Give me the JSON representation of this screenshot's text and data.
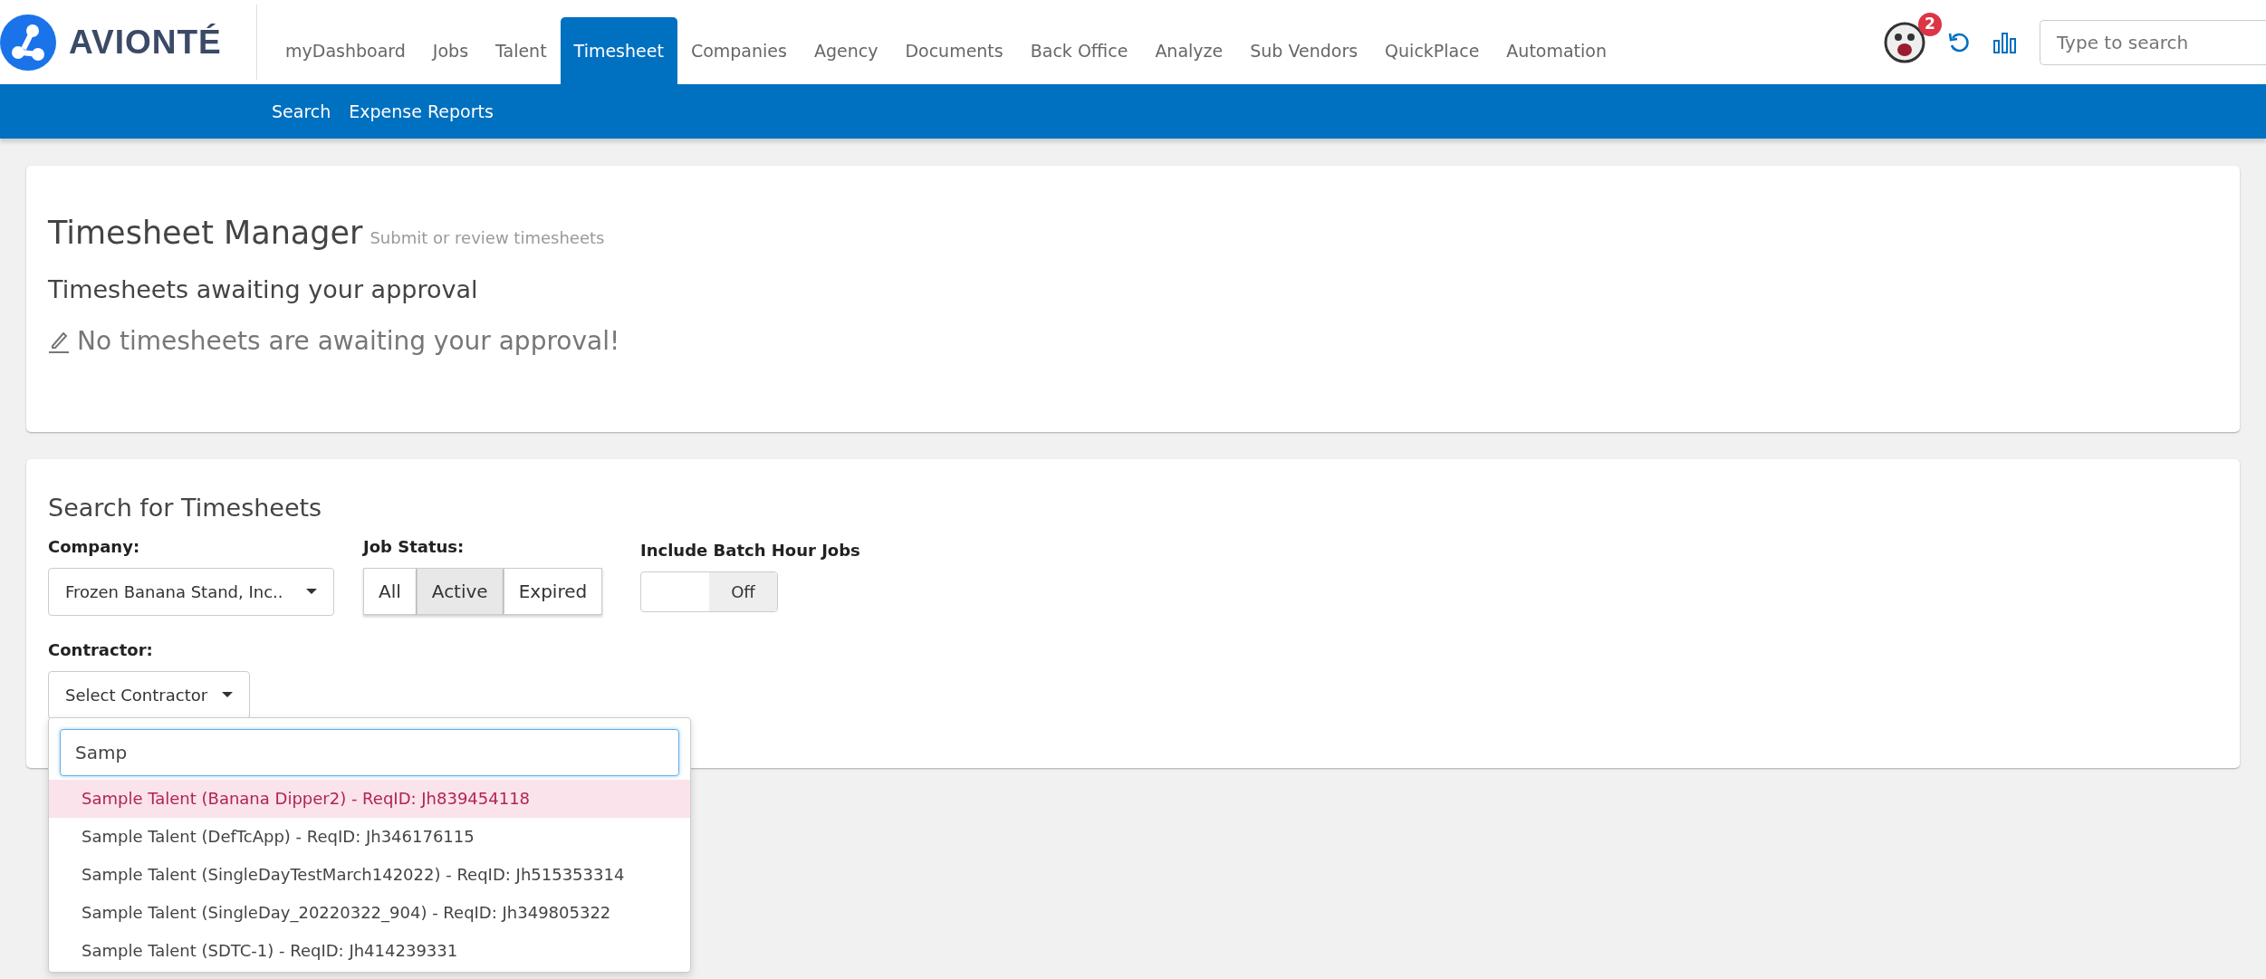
{
  "brand": {
    "name": "AVIONTÉ"
  },
  "nav": [
    {
      "label": "myDashboard",
      "selected": false
    },
    {
      "label": "Jobs",
      "selected": false
    },
    {
      "label": "Talent",
      "selected": false
    },
    {
      "label": "Timesheet",
      "selected": true
    },
    {
      "label": "Companies",
      "selected": false
    },
    {
      "label": "Agency",
      "selected": false
    },
    {
      "label": "Documents",
      "selected": false
    },
    {
      "label": "Back Office",
      "selected": false
    },
    {
      "label": "Analyze",
      "selected": false
    },
    {
      "label": "Sub Vendors",
      "selected": false
    },
    {
      "label": "QuickPlace",
      "selected": false
    },
    {
      "label": "Automation",
      "selected": false
    }
  ],
  "notifications": {
    "count": "2"
  },
  "search": {
    "placeholder": "Type to search"
  },
  "subnav": [
    "Search",
    "Expense Reports"
  ],
  "manager": {
    "title": "Timesheet Manager",
    "subtitle": "Submit or review timesheets",
    "heading": "Timesheets awaiting your approval",
    "message": "No timesheets are awaiting your approval!"
  },
  "search_form": {
    "title": "Search for Timesheets",
    "company": {
      "label": "Company:",
      "value": "Frozen Banana Stand, Inc.."
    },
    "job_status": {
      "label": "Job Status:",
      "options": [
        {
          "label": "All",
          "selected": false
        },
        {
          "label": "Active",
          "selected": true
        },
        {
          "label": "Expired",
          "selected": false
        }
      ]
    },
    "batch": {
      "label": "Include Batch Hour Jobs",
      "state": "Off",
      "on": false
    },
    "contractor": {
      "label": "Contractor:",
      "value": "Select Contractor",
      "dropdown": {
        "query": "Samp",
        "options": [
          {
            "label": "Sample Talent (Banana Dipper2) - ReqID: Jh839454118",
            "selected": true
          },
          {
            "label": "Sample Talent (DefTcApp) - ReqID: Jh346176115",
            "selected": false
          },
          {
            "label": "Sample Talent (SingleDayTestMarch142022) - ReqID: Jh515353314",
            "selected": false
          },
          {
            "label": "Sample Talent (SingleDay_20220322_904) - ReqID: Jh349805322",
            "selected": false
          },
          {
            "label": "Sample Talent (SDTC-1) - ReqID: Jh414239331",
            "selected": false
          }
        ]
      }
    }
  }
}
